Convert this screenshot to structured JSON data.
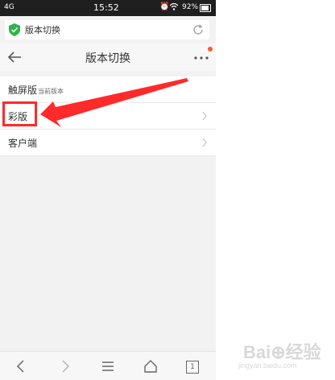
{
  "status_bar": {
    "network": "4G",
    "time": "15:52",
    "battery": "92%"
  },
  "address_bar": {
    "title": "版本切换"
  },
  "nav": {
    "title": "版本切换"
  },
  "list": [
    {
      "label": "触屏版",
      "sub": "当前版本"
    },
    {
      "label": "彩版",
      "sub": ""
    },
    {
      "label": "客户端",
      "sub": ""
    }
  ],
  "tabs_count": "1",
  "watermark": {
    "text": "Bai⊕经验",
    "url": "jingyan.baidu.com"
  },
  "colors": {
    "annotation_red": "#ff2a2a",
    "shield_green": "#2db54a",
    "notify_dot": "#ff5a2a"
  }
}
